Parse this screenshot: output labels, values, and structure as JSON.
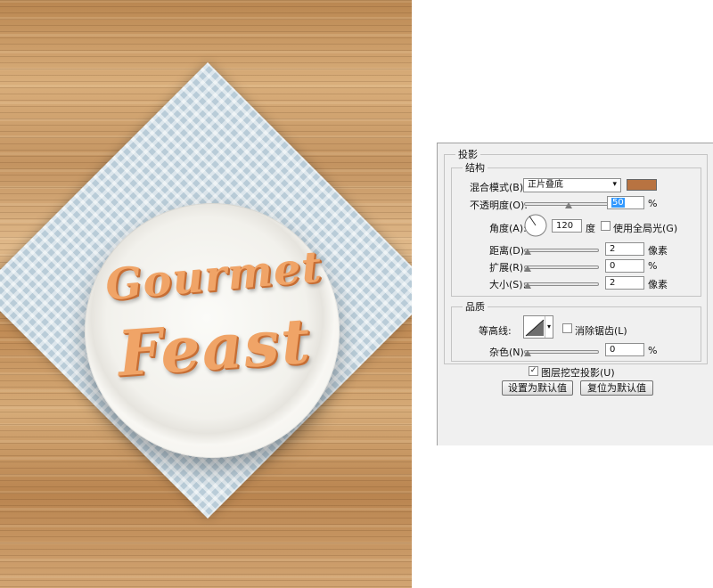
{
  "artwork": {
    "title_line1": "Gourmet",
    "title_line2": "Feast"
  },
  "panel": {
    "title": "投影",
    "structure": {
      "legend": "结构",
      "blend_mode_label": "混合模式(B):",
      "blend_mode_value": "正片叠底",
      "shadow_color": "#b87341",
      "opacity_label": "不透明度(O):",
      "opacity_value": "50",
      "opacity_unit": "%",
      "opacity_fraction": 0.5,
      "angle_label": "角度(A):",
      "angle_value": "120",
      "angle_unit": "度",
      "global_light_label": "使用全局光(G)",
      "global_light_checked": false,
      "distance_label": "距离(D):",
      "distance_value": "2",
      "distance_unit": "像素",
      "spread_label": "扩展(R):",
      "spread_value": "0",
      "spread_unit": "%",
      "size_label": "大小(S):",
      "size_value": "2",
      "size_unit": "像素"
    },
    "quality": {
      "legend": "品质",
      "contour_label": "等高线:",
      "antialias_label": "消除锯齿(L)",
      "antialias_checked": false,
      "noise_label": "杂色(N):",
      "noise_value": "0",
      "noise_unit": "%"
    },
    "knockout_label": "图层挖空投影(U)",
    "knockout_checked": true,
    "set_default_button": "设置为默认值",
    "reset_default_button": "复位为默认值"
  }
}
